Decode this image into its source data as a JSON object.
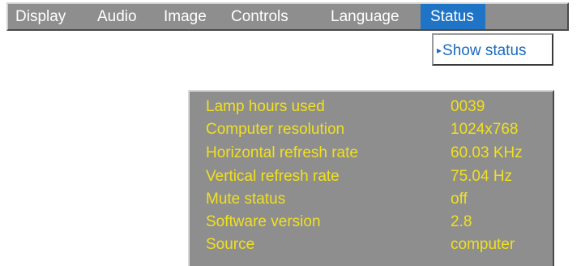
{
  "menu": {
    "tabs": [
      {
        "label": "Display"
      },
      {
        "label": "Audio"
      },
      {
        "label": "Image"
      },
      {
        "label": "Controls"
      },
      {
        "label": "Language"
      },
      {
        "label": "Status",
        "active": true
      }
    ]
  },
  "submenu": {
    "arrow": "▸",
    "item_label": "Show status"
  },
  "status": {
    "rows": [
      {
        "label": "Lamp hours used",
        "value": "0039"
      },
      {
        "label": "Computer resolution",
        "value": "1024x768"
      },
      {
        "label": "Horizontal refresh rate",
        "value": "60.03 KHz"
      },
      {
        "label": "Vertical refresh rate",
        "value": "75.04 Hz"
      },
      {
        "label": "Mute status",
        "value": "off"
      },
      {
        "label": "Software version",
        "value": "2.8"
      },
      {
        "label": "Source",
        "value": "computer"
      }
    ]
  },
  "colors": {
    "bar_background": "#8e8e8e",
    "active_tab": "#1f74c6",
    "status_text": "#f0e020",
    "submenu_text": "#1a6bbf"
  }
}
